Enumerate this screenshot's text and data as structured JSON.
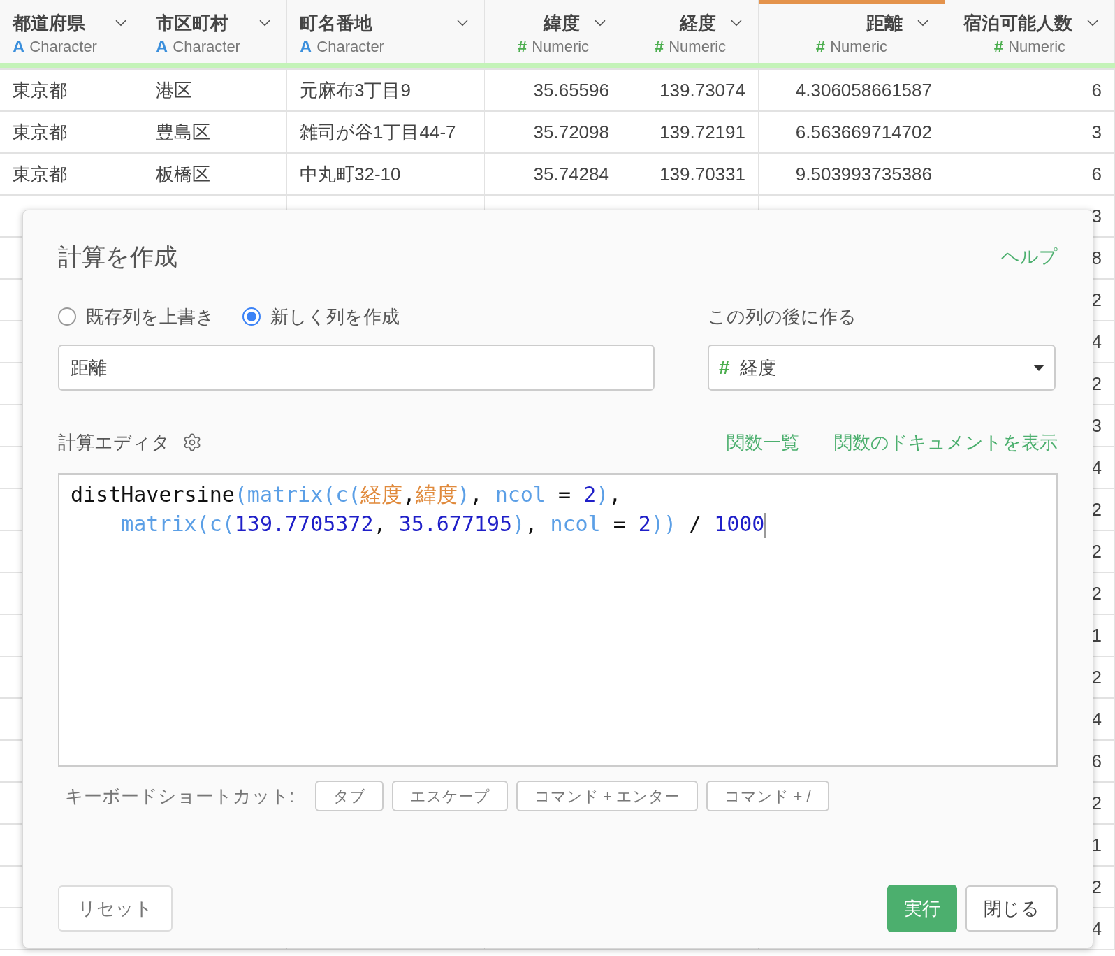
{
  "table": {
    "columns": [
      {
        "name": "都道府県",
        "type_icon": "A",
        "type": "Character",
        "kind": "character",
        "selected": false
      },
      {
        "name": "市区町村",
        "type_icon": "A",
        "type": "Character",
        "kind": "character",
        "selected": false
      },
      {
        "name": "町名番地",
        "type_icon": "A",
        "type": "Character",
        "kind": "character",
        "selected": false
      },
      {
        "name": "緯度",
        "type_icon": "#",
        "type": "Numeric",
        "kind": "numeric",
        "selected": false
      },
      {
        "name": "経度",
        "type_icon": "#",
        "type": "Numeric",
        "kind": "numeric",
        "selected": false
      },
      {
        "name": "距離",
        "type_icon": "#",
        "type": "Numeric",
        "kind": "numeric",
        "selected": true
      },
      {
        "name": "宿泊可能人数",
        "type_icon": "#",
        "type": "Numeric",
        "kind": "numeric",
        "selected": false
      }
    ],
    "rows": [
      [
        "東京都",
        "港区",
        "元麻布3丁目9",
        "35.65596",
        "139.73074",
        "4.306058661587",
        "6"
      ],
      [
        "東京都",
        "豊島区",
        "雑司が谷1丁目44-7",
        "35.72098",
        "139.72191",
        "6.563669714702",
        "3"
      ],
      [
        "東京都",
        "板橋区",
        "中丸町32-10",
        "35.74284",
        "139.70331",
        "9.503993735386",
        "6"
      ],
      [
        null,
        null,
        null,
        null,
        null,
        null,
        "3"
      ],
      [
        null,
        null,
        null,
        null,
        null,
        null,
        "8"
      ],
      [
        null,
        null,
        null,
        null,
        null,
        null,
        "2"
      ],
      [
        null,
        null,
        null,
        null,
        null,
        null,
        "4"
      ],
      [
        null,
        null,
        null,
        null,
        null,
        null,
        "2"
      ],
      [
        null,
        null,
        null,
        null,
        null,
        null,
        "3"
      ],
      [
        null,
        null,
        null,
        null,
        null,
        null,
        "4"
      ],
      [
        null,
        null,
        null,
        null,
        null,
        null,
        "2"
      ],
      [
        null,
        null,
        null,
        null,
        null,
        null,
        "2"
      ],
      [
        null,
        null,
        null,
        null,
        null,
        null,
        "2"
      ],
      [
        null,
        null,
        null,
        null,
        null,
        null,
        "1"
      ],
      [
        null,
        null,
        null,
        null,
        null,
        null,
        "2"
      ],
      [
        null,
        null,
        null,
        null,
        null,
        null,
        "4"
      ],
      [
        null,
        null,
        null,
        null,
        null,
        null,
        "6"
      ],
      [
        null,
        null,
        null,
        null,
        null,
        null,
        "2"
      ],
      [
        null,
        null,
        null,
        null,
        null,
        null,
        "1"
      ],
      [
        null,
        null,
        null,
        null,
        null,
        null,
        "2"
      ],
      [
        null,
        null,
        null,
        null,
        null,
        null,
        "4"
      ]
    ]
  },
  "dialog": {
    "title": "計算を作成",
    "help_link": "ヘルプ",
    "mode_options": [
      {
        "label": "既存列を上書き",
        "selected": false
      },
      {
        "label": "新しく列を作成",
        "selected": true
      }
    ],
    "column_name": {
      "value": "距離"
    },
    "position_label": "この列の後に作る",
    "position_select": {
      "type_icon": "#",
      "value": "経度"
    },
    "editor_label": "計算エディタ",
    "function_list_link": "関数一覧",
    "function_docs_link": "関数のドキュメントを表示",
    "code_lines": [
      [
        {
          "kind": "text",
          "text": "distHaversine"
        },
        {
          "kind": "call",
          "text": "(matrix(c("
        },
        {
          "kind": "column",
          "text": "経度"
        },
        {
          "kind": "text",
          "text": ","
        },
        {
          "kind": "column",
          "text": "緯度"
        },
        {
          "kind": "call",
          "text": ")"
        },
        {
          "kind": "text",
          "text": ", "
        },
        {
          "kind": "call",
          "text": "ncol"
        },
        {
          "kind": "text",
          "text": " = "
        },
        {
          "kind": "number",
          "text": "2"
        },
        {
          "kind": "call",
          "text": ")"
        },
        {
          "kind": "text",
          "text": ","
        }
      ],
      [
        {
          "kind": "call",
          "text": "    matrix(c("
        },
        {
          "kind": "number",
          "text": "139.7705372"
        },
        {
          "kind": "text",
          "text": ", "
        },
        {
          "kind": "number",
          "text": "35.677195"
        },
        {
          "kind": "call",
          "text": ")"
        },
        {
          "kind": "text",
          "text": ", "
        },
        {
          "kind": "call",
          "text": "ncol"
        },
        {
          "kind": "text",
          "text": " = "
        },
        {
          "kind": "number",
          "text": "2"
        },
        {
          "kind": "call",
          "text": "))"
        },
        {
          "kind": "text",
          "text": " / "
        },
        {
          "kind": "number",
          "text": "1000"
        }
      ]
    ],
    "shortcuts_label": "キーボードショートカット:",
    "shortcuts": [
      "タブ",
      "エスケープ",
      "コマンド + エンター",
      "コマンド + /"
    ],
    "reset_button": "リセット",
    "run_button": "実行",
    "close_button": "閉じる"
  }
}
